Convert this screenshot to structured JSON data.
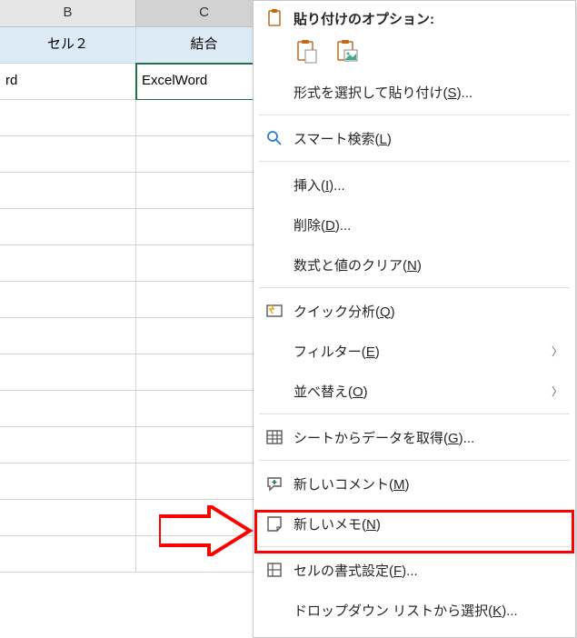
{
  "columns": [
    "B",
    "C"
  ],
  "header_row": [
    "セル２",
    "結合"
  ],
  "data_row": [
    "rd",
    "ExcelWord"
  ],
  "menu": {
    "paste_options_label": "貼り付けのオプション:",
    "paste_special": "形式を選択して貼り付け(",
    "paste_special_u": "S",
    "paste_special_end": ")...",
    "smart_lookup": "スマート検索(",
    "smart_lookup_u": "L",
    "smart_lookup_end": ")",
    "insert": "挿入(",
    "insert_u": "I",
    "insert_end": ")...",
    "delete": "削除(",
    "delete_u": "D",
    "delete_end": ")...",
    "clear": "数式と値のクリア(",
    "clear_u": "N",
    "clear_end": ")",
    "quick": "クイック分析(",
    "quick_u": "Q",
    "quick_end": ")",
    "filter": "フィルター(",
    "filter_u": "E",
    "filter_end": ")",
    "sort": "並べ替え(",
    "sort_u": "O",
    "sort_end": ")",
    "getdata": "シートからデータを取得(",
    "getdata_u": "G",
    "getdata_end": ")...",
    "newcomment": "新しいコメント(",
    "newcomment_u": "M",
    "newcomment_end": ")",
    "newnote": "新しいメモ(",
    "newnote_u": "N",
    "newnote_end": ")",
    "formatcells": "セルの書式設定(",
    "formatcells_u": "F",
    "formatcells_end": ")...",
    "dropdown": "ドロップダウン リストから選択(",
    "dropdown_u": "K",
    "dropdown_end": ")..."
  }
}
